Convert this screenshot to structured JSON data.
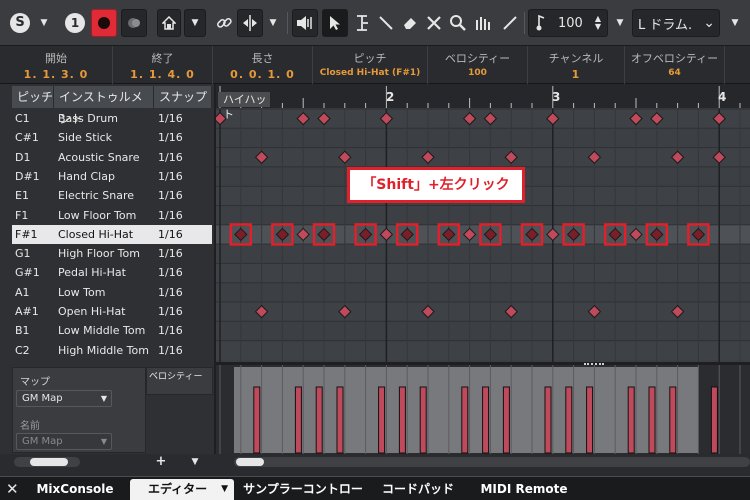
{
  "toolbar": {
    "solo_label": "S",
    "listen_label": "1",
    "snap_value": "100",
    "drum_map": "L ドラム."
  },
  "info": {
    "start_label": "開始",
    "start_value": "1. 1. 3.  0",
    "end_label": "終了",
    "end_value": "1. 1. 4.  0",
    "length_label": "長さ",
    "length_value": "0. 0. 1.  0",
    "pitch_label": "ピッチ",
    "pitch_value": "Closed Hi-Hat (F#1)",
    "velocity_label": "ベロシティー",
    "velocity_value": "100",
    "channel_label": "チャンネル",
    "channel_value": "1",
    "offvel_label": "オフベロシティー",
    "offvel_value": "64"
  },
  "list": {
    "headers": {
      "pitch": "ピッチ",
      "instrument": "インストゥルメント",
      "snap": "スナップ"
    },
    "rows": [
      {
        "pitch": "C1",
        "instrument": "Bass Drum",
        "snap": "1/16"
      },
      {
        "pitch": "C#1",
        "instrument": "Side Stick",
        "snap": "1/16"
      },
      {
        "pitch": "D1",
        "instrument": "Acoustic Snare",
        "snap": "1/16"
      },
      {
        "pitch": "D#1",
        "instrument": "Hand Clap",
        "snap": "1/16"
      },
      {
        "pitch": "E1",
        "instrument": "Electric Snare",
        "snap": "1/16"
      },
      {
        "pitch": "F1",
        "instrument": "Low Floor Tom",
        "snap": "1/16"
      },
      {
        "pitch": "F#1",
        "instrument": "Closed Hi-Hat",
        "snap": "1/16"
      },
      {
        "pitch": "G1",
        "instrument": "High Floor Tom",
        "snap": "1/16"
      },
      {
        "pitch": "G#1",
        "instrument": "Pedal Hi-Hat",
        "snap": "1/16"
      },
      {
        "pitch": "A1",
        "instrument": "Low Tom",
        "snap": "1/16"
      },
      {
        "pitch": "A#1",
        "instrument": "Open Hi-Hat",
        "snap": "1/16"
      },
      {
        "pitch": "B1",
        "instrument": "Low Middle Tom",
        "snap": "1/16"
      },
      {
        "pitch": "C2",
        "instrument": "High Middle Tom",
        "snap": "1/16"
      }
    ]
  },
  "ruler": {
    "marker_label": "ハイハット",
    "bar2": "2",
    "bar3": "3",
    "bar4": "4"
  },
  "annotation": "「Shift」+左クリック",
  "lower": {
    "map_label": "マップ",
    "map_value": "GM Map",
    "name_label": "名前",
    "name_value": "GM Map",
    "velocity_label": "ベロシティー"
  },
  "tabs": [
    "MixConsole",
    "エディター",
    "サンプラーコントロール",
    "コードパッド",
    "MIDI Remote"
  ],
  "colors": {
    "note": "#c04a5c",
    "highlight": "#e0202a",
    "orange": "#e79a3a",
    "record": "#e02a35"
  }
}
